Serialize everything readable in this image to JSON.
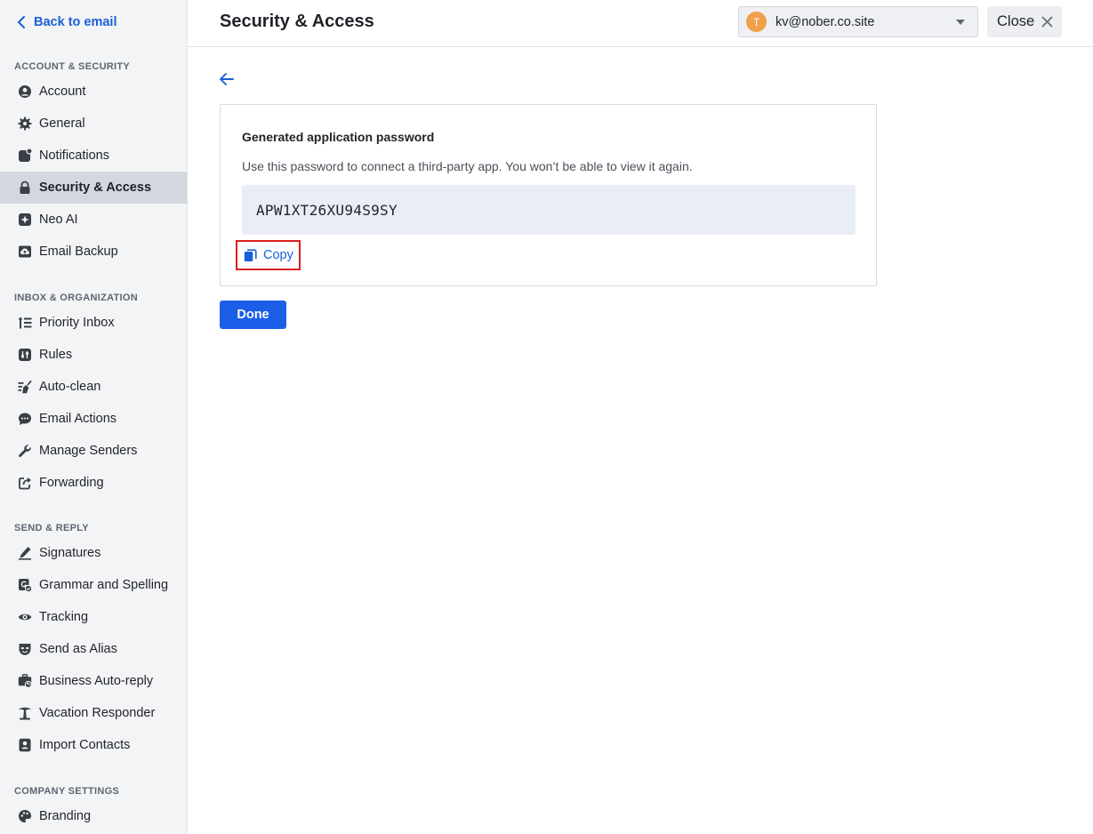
{
  "sidebar": {
    "back_label": "Back to email",
    "sections": {
      "account_security": "ACCOUNT & SECURITY",
      "inbox_org": "INBOX & ORGANIZATION",
      "send_reply": "SEND & REPLY",
      "company": "COMPANY SETTINGS"
    },
    "items": {
      "account": "Account",
      "general": "General",
      "notifications": "Notifications",
      "security": "Security & Access",
      "neo_ai": "Neo AI",
      "email_backup": "Email Backup",
      "priority_inbox": "Priority Inbox",
      "rules": "Rules",
      "auto_clean": "Auto-clean",
      "email_actions": "Email Actions",
      "manage_senders": "Manage Senders",
      "forwarding": "Forwarding",
      "signatures": "Signatures",
      "grammar": "Grammar and Spelling",
      "tracking": "Tracking",
      "send_as_alias": "Send as Alias",
      "business_auto_reply": "Business Auto-reply",
      "vacation_responder": "Vacation Responder",
      "import_contacts": "Import Contacts",
      "branding": "Branding"
    },
    "active_item": "security"
  },
  "header": {
    "title": "Security & Access",
    "account": {
      "avatar_letter": "T",
      "email": "kv@nober.co.site"
    },
    "close_label": "Close"
  },
  "main": {
    "card": {
      "title": "Generated application password",
      "description": "Use this password to connect a third-party app. You won’t be able to view it again.",
      "password": "APW1XT26XU94S9SY",
      "copy_label": "Copy"
    },
    "done_label": "Done"
  },
  "colors": {
    "accent": "#1b5fe8",
    "link": "#1b5fd8",
    "avatar": "#f0a04b",
    "highlight_border": "#d92020"
  }
}
